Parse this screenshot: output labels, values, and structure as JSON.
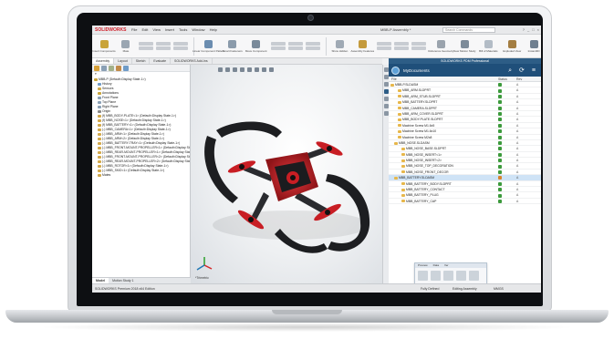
{
  "app": {
    "brand": "SOLIDWORKS",
    "window_title": "MBB-P Assembly *",
    "menu": [
      "File",
      "Edit",
      "View",
      "Insert",
      "Tools",
      "Window",
      "Help"
    ],
    "search_placeholder": "Search Commands",
    "window_buttons": [
      "?",
      "_",
      "□",
      "×"
    ]
  },
  "ribbon": {
    "buttons": [
      {
        "label": "Insert Components",
        "icon": "insert-components-icon"
      },
      {
        "label": "Mate",
        "icon": "mate-icon"
      },
      {
        "label": "Linear Component Pattern",
        "icon": "pattern-icon"
      },
      {
        "label": "Smart Fasteners",
        "icon": "fastener-icon"
      },
      {
        "label": "Move Component",
        "icon": "move-icon"
      },
      {
        "label": "Show Hidden",
        "icon": "show-hidden-icon"
      },
      {
        "label": "Assembly Features",
        "icon": "features-icon"
      },
      {
        "label": "Reference Geometry",
        "icon": "reference-icon"
      },
      {
        "label": "New Motion Study",
        "icon": "motion-icon"
      },
      {
        "label": "Bill of Materials",
        "icon": "bom-icon"
      },
      {
        "label": "Exploded View",
        "icon": "explode-icon"
      },
      {
        "label": "Instant3D",
        "icon": "instant3d-icon"
      }
    ]
  },
  "command_tabs": [
    "Assembly",
    "Layout",
    "Sketch",
    "Evaluate",
    "SOLIDWORKS Add-Ins"
  ],
  "tree": {
    "filter": "▾",
    "items": [
      "MBB-P (Default<Display State-1>)",
      "History",
      "Sensors",
      "Annotations",
      "Front Plane",
      "Top Plane",
      "Right Plane",
      "Origin",
      "(f) MBB_BODY-PLATE<1> (Default<Display State-1>)",
      "(f) MBB_NOSE<1> (Default<Display State-1>)",
      "(f) MBB_BATTERY<1> (Default<Display State-1>)",
      "(-) MBB_CAMERA<1> (Default<Display State-1>)",
      "(-) MBB_ARM<1> (Default<Display State-1>)",
      "(-) MBB_ARM<2> (Default<Display State-1>)",
      "(-) MBB_BATTERY-TRAY<1> (Default<Display State-1>)",
      "(-) MBB_FRONT-MOUNT-PROPELLER<1> (Default<Display State-1>)",
      "(-) MBB_REAR-MOUNT-PROPELLER<1> (Default<Display State-1>)",
      "(-) MBB_FRONT-MOUNT-PROPELLER<2> (Default<Display State-1>)",
      "(-) MBB_REAR-MOUNT-PROPELLER<2> (Default<Display State-1>)",
      "(-) MBB_ROTOR<1> (Default<Display State-1>)",
      "(-) MBB_SKID<1> (Default<Display State-1>)",
      "Mates"
    ],
    "bottom_tabs": [
      "Model",
      "Motion Study 1"
    ]
  },
  "viewport": {
    "triad_label": "*Trimetric"
  },
  "pdm": {
    "header": "SOLIDWORKS PDM Professional",
    "vault": "MyDocuments",
    "columns": [
      "File",
      "Status",
      "Rev"
    ],
    "rows": [
      {
        "name": "MBB-P.SLDASM",
        "status_color": "#3c9a3c",
        "rev": "A"
      },
      {
        "name": "MBB_ARM.SLDPRT",
        "status_color": "#3c9a3c",
        "rev": "A"
      },
      {
        "name": "MBB_ARM_STUB.SLDPRT",
        "status_color": "#3c9a3c",
        "rev": "A"
      },
      {
        "name": "MBB_BATTERY.SLDPRT",
        "status_color": "#3c9a3c",
        "rev": "A"
      },
      {
        "name": "MBB_CAMERA.SLDPRT",
        "status_color": "#3c9a3c",
        "rev": "A"
      },
      {
        "name": "MBB_ARM_COVER.SLDPRT",
        "status_color": "#3c9a3c",
        "rev": "A"
      },
      {
        "name": "MBB_BODY-PLATE.SLDPRT",
        "status_color": "#3c9a3c",
        "rev": "A"
      },
      {
        "name": "Machine Screw M1.6x5",
        "status_color": "#3c9a3c",
        "rev": "A"
      },
      {
        "name": "Machine Screw M1.6x10",
        "status_color": "#3c9a3c",
        "rev": "A"
      },
      {
        "name": "Machine Screw M2x8",
        "status_color": "#3c9a3c",
        "rev": "A"
      },
      {
        "name": "MBB_NOSE.SLDASM",
        "status_color": "#3c9a3c",
        "rev": "A"
      },
      {
        "name": "MBB_NOSE_BASE.SLDPRT",
        "status_color": "#3c9a3c",
        "rev": "A"
      },
      {
        "name": "MBB_NOSE_INSERT<1>",
        "status_color": "#3c9a3c",
        "rev": "A"
      },
      {
        "name": "MBB_NOSE_INSERT<2>",
        "status_color": "#3c9a3c",
        "rev": "A"
      },
      {
        "name": "MBB_NOSE_TOP_DECORATION",
        "status_color": "#3c9a3c",
        "rev": "A"
      },
      {
        "name": "MBB_NOSE_FRONT_DECOR",
        "status_color": "#3c9a3c",
        "rev": "A"
      },
      {
        "name": "MBB_BATTERY.SLDASM",
        "status_color": "#d9822b",
        "rev": "A"
      },
      {
        "name": "MBB_BATTERY_BODY.SLDPRT",
        "status_color": "#3c9a3c",
        "rev": "A"
      },
      {
        "name": "MBB_BATTERY_CONTACT",
        "status_color": "#3c9a3c",
        "rev": "A"
      },
      {
        "name": "MBB_BATTERY_PLUG",
        "status_color": "#3c9a3c",
        "rev": "A"
      },
      {
        "name": "MBB_BATTERY_CAP",
        "status_color": "#3c9a3c",
        "rev": "A"
      }
    ],
    "preview_tabs": [
      "Preview",
      "Data",
      "Ver"
    ]
  },
  "status": {
    "left": "SOLIDWORKS Premium 2018 x64 Edition",
    "fully_defined": "Fully Defined",
    "editing": "Editing Assembly",
    "units": "MMGS"
  },
  "colors": {
    "accent": "#1f4f7a",
    "brand": "#d0202a",
    "drone_red": "#c81e24",
    "drone_black": "#1b1c1f"
  }
}
